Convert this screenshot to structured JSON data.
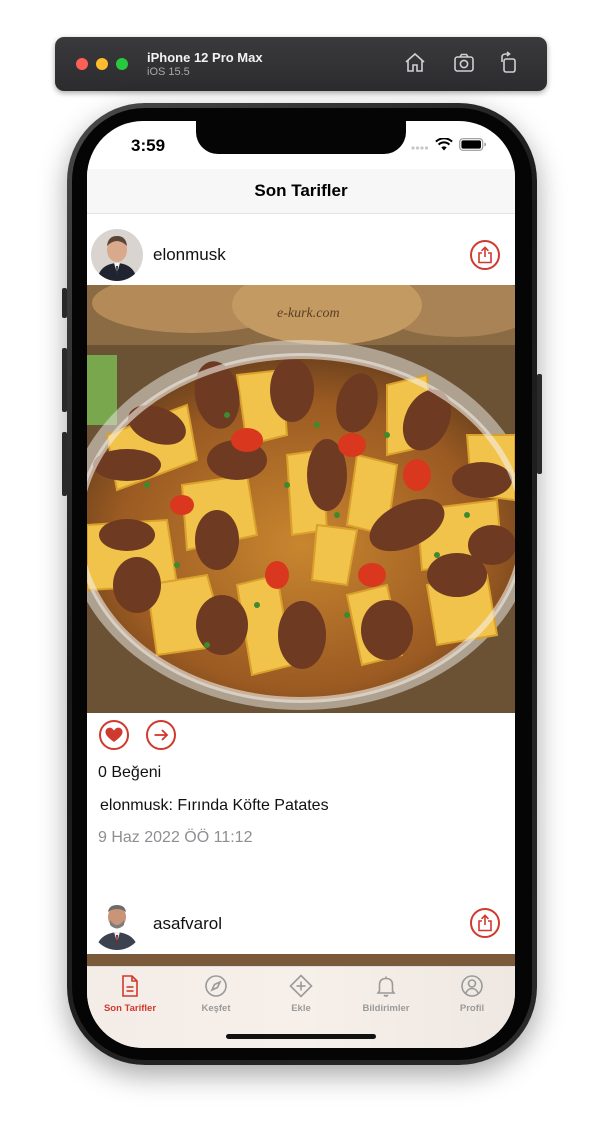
{
  "simulator": {
    "device_name": "iPhone 12 Pro Max",
    "os_version": "iOS 15.5",
    "icons": [
      "home-icon",
      "screenshot-icon",
      "rotate-icon"
    ]
  },
  "status_bar": {
    "time": "3:59",
    "icons": [
      "cellular-dots-icon",
      "wifi-icon",
      "battery-icon"
    ]
  },
  "nav": {
    "title": "Son Tarifler"
  },
  "posts": [
    {
      "username": "elonmusk",
      "likes": "0 Beğeni",
      "caption": "elonmusk: Fırında Köfte Patates",
      "date": "9 Haz 2022 ÖÖ 11:12",
      "photo_watermark": "e-kurk.com"
    },
    {
      "username": "asafvarol"
    }
  ],
  "tabs": [
    {
      "label": "Son Tarifler",
      "icon": "document-icon",
      "active": true
    },
    {
      "label": "Keşfet",
      "icon": "compass-icon",
      "active": false
    },
    {
      "label": "Ekle",
      "icon": "add-icon",
      "active": false
    },
    {
      "label": "Bildirimler",
      "icon": "bell-icon",
      "active": false
    },
    {
      "label": "Profil",
      "icon": "profile-icon",
      "active": false
    }
  ],
  "colors": {
    "accent": "#d0392e",
    "tab_inactive": "#9a9a9a",
    "date_gray": "#8e8e93"
  }
}
